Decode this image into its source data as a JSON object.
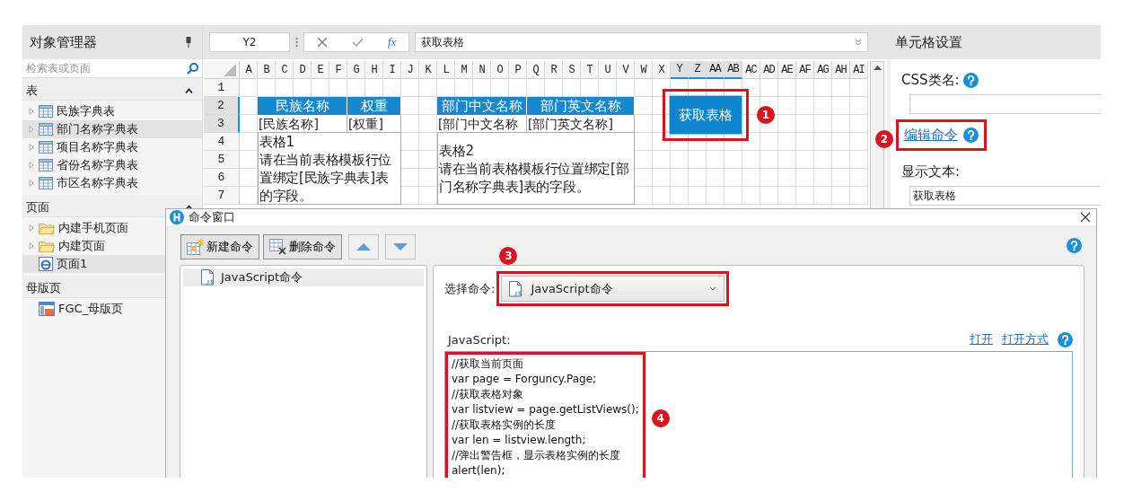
{
  "object_manager": {
    "title": "对象管理器",
    "search": {
      "placeholder": "检索表或页面"
    },
    "sections": [
      {
        "title": "表",
        "items": [
          {
            "label": "民族字典表",
            "kind": "table",
            "selected": false,
            "expandable": true
          },
          {
            "label": "部门名称字典表",
            "kind": "table",
            "selected": true,
            "expandable": true
          },
          {
            "label": "项目名称字典表",
            "kind": "table",
            "selected": false,
            "expandable": true
          },
          {
            "label": "省份名称字典表",
            "kind": "table",
            "selected": false,
            "expandable": true
          },
          {
            "label": "市区名称字典表",
            "kind": "table",
            "selected": false,
            "expandable": true
          }
        ]
      },
      {
        "title": "页面",
        "items": [
          {
            "label": "内建手机页面",
            "kind": "folder",
            "selected": false,
            "expandable": true
          },
          {
            "label": "内建页面",
            "kind": "folder",
            "selected": false,
            "expandable": true
          },
          {
            "label": "页面1",
            "kind": "page",
            "selected": true,
            "expandable": false
          }
        ]
      },
      {
        "title": "母版页",
        "items": [
          {
            "label": "FGC_母版页",
            "kind": "master",
            "selected": false,
            "expandable": false
          }
        ]
      }
    ]
  },
  "formula_bar": {
    "cell_ref": "Y2",
    "function_symbol": "fx",
    "value": "获取表格"
  },
  "sheet": {
    "columns": [
      {
        "label": "A",
        "selected": false
      },
      {
        "label": "B",
        "selected": false
      },
      {
        "label": "C",
        "selected": false
      },
      {
        "label": "D",
        "selected": false
      },
      {
        "label": "E",
        "selected": false
      },
      {
        "label": "F",
        "selected": false
      },
      {
        "label": "G",
        "selected": false
      },
      {
        "label": "H",
        "selected": false
      },
      {
        "label": "I",
        "selected": false
      },
      {
        "label": "J",
        "selected": false
      },
      {
        "label": "K",
        "selected": false
      },
      {
        "label": "L",
        "selected": false
      },
      {
        "label": "M",
        "selected": false
      },
      {
        "label": "N",
        "selected": false
      },
      {
        "label": "O",
        "selected": false
      },
      {
        "label": "P",
        "selected": false
      },
      {
        "label": "Q",
        "selected": false
      },
      {
        "label": "R",
        "selected": false
      },
      {
        "label": "S",
        "selected": false
      },
      {
        "label": "T",
        "selected": false
      },
      {
        "label": "U",
        "selected": false
      },
      {
        "label": "V",
        "selected": false
      },
      {
        "label": "W",
        "selected": false
      },
      {
        "label": "X",
        "selected": false
      },
      {
        "label": "Y",
        "selected": true
      },
      {
        "label": "Z",
        "selected": true
      },
      {
        "label": "AA",
        "selected": true
      },
      {
        "label": "AB",
        "selected": true
      },
      {
        "label": "AC",
        "selected": false
      },
      {
        "label": "AD",
        "selected": false
      },
      {
        "label": "AE",
        "selected": false
      },
      {
        "label": "AF",
        "selected": false
      },
      {
        "label": "AG",
        "selected": false
      },
      {
        "label": "AH",
        "selected": false
      },
      {
        "label": "AI",
        "selected": false
      }
    ],
    "rows": [
      {
        "label": "1",
        "selected": false
      },
      {
        "label": "2",
        "selected": true
      },
      {
        "label": "3",
        "selected": true
      },
      {
        "label": "4",
        "selected": false
      },
      {
        "label": "5",
        "selected": false
      },
      {
        "label": "6",
        "selected": false
      },
      {
        "label": "7",
        "selected": false
      }
    ],
    "cells": [
      {
        "kind": "header",
        "text": "民族名称"
      },
      {
        "kind": "header",
        "text": "权重"
      },
      {
        "kind": "field",
        "text": "[民族名称]"
      },
      {
        "kind": "field",
        "text": "[权重]"
      },
      {
        "kind": "note",
        "title": "表格1",
        "text": "请在当前表格模板行位置绑定[民族字典表]表的字段。"
      },
      {
        "kind": "header",
        "text": "部门中文名称"
      },
      {
        "kind": "header",
        "text": "部门英文名称"
      },
      {
        "kind": "field",
        "text": "[部门中文名称"
      },
      {
        "kind": "field",
        "text": "[部门英文名称]"
      },
      {
        "kind": "note",
        "title": "表格2",
        "text": "请在当前表格模板行位置绑定[部门名称字典表]表的字段。"
      }
    ],
    "button": {
      "label": "获取表格",
      "callout": "1"
    }
  },
  "cell_settings": {
    "title": "单元格设置",
    "css_label": "CSS类名:",
    "edit_command": {
      "label": "编辑命令",
      "callout": "2"
    },
    "display_text": {
      "label": "显示文本:",
      "value": "获取表格"
    }
  },
  "dialog": {
    "title": "命令窗口",
    "toolbar": [
      {
        "kind": "new",
        "label": "新建命令",
        "disabled": false
      },
      {
        "kind": "delete",
        "label": "删除命令",
        "disabled": false
      },
      {
        "kind": "up",
        "disabled": true
      },
      {
        "kind": "down",
        "disabled": true
      }
    ],
    "commands": [
      {
        "label": "JavaScript命令",
        "selected": true
      }
    ],
    "select_label": "选择命令:",
    "selected_command": {
      "value": "JavaScript命令",
      "callout": "3"
    },
    "script_label": "JavaScript:",
    "links": [
      "打开",
      "打开方式"
    ],
    "code": {
      "callout": "4",
      "lines": [
        "//获取当前页面",
        "var page = Forguncy.Page;",
        "//获取表格对象",
        "var listview = page.getListViews();",
        "//获取表格实例的长度",
        "var len = listview.length;",
        "//弹出警告框，显示表格实例的长度",
        "alert(len);"
      ]
    }
  }
}
